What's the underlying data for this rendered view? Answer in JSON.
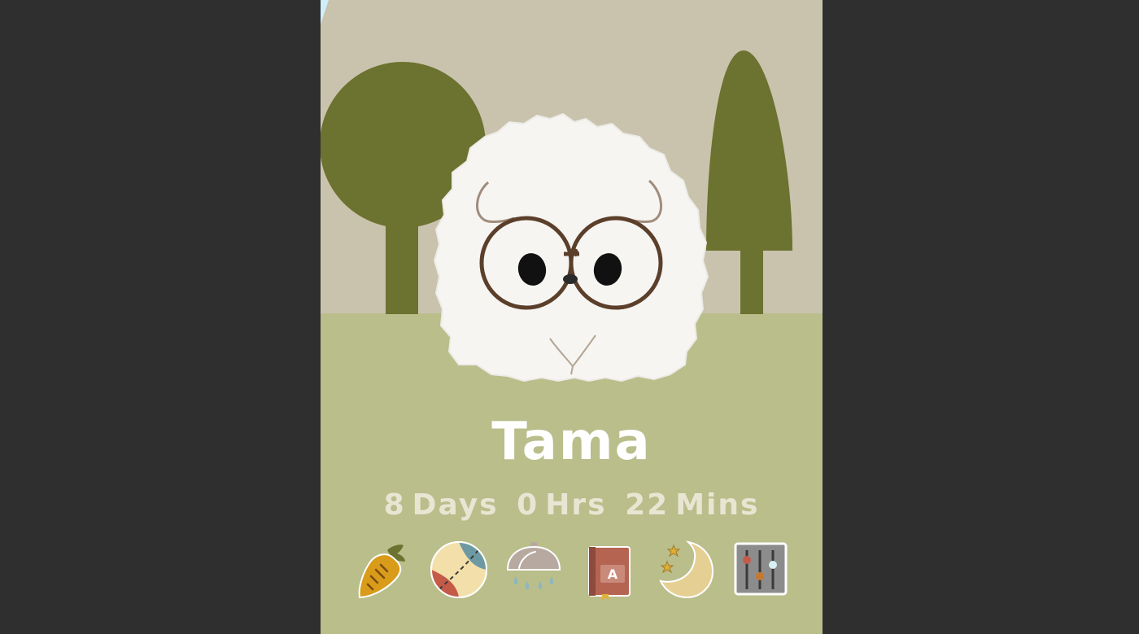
{
  "pet": {
    "name": "Tama",
    "age": {
      "days": "8",
      "days_unit": "Days",
      "hours": "0",
      "hours_unit": "Hrs",
      "minutes": "22",
      "minutes_unit": "Mins"
    }
  },
  "actions": [
    {
      "id": "feed",
      "icon": "carrot-icon"
    },
    {
      "id": "play",
      "icon": "ball-icon"
    },
    {
      "id": "clean",
      "icon": "shower-icon"
    },
    {
      "id": "learn",
      "icon": "book-icon"
    },
    {
      "id": "sleep",
      "icon": "moon-icon"
    },
    {
      "id": "settings",
      "icon": "sliders-icon"
    }
  ],
  "colors": {
    "background": "#2f2f2f",
    "sky": "#c9c3ad",
    "grass": "#b9be8b",
    "trees": "#6c722f",
    "fur": "#f6f5f2",
    "glasses": "#5b3f2a"
  }
}
